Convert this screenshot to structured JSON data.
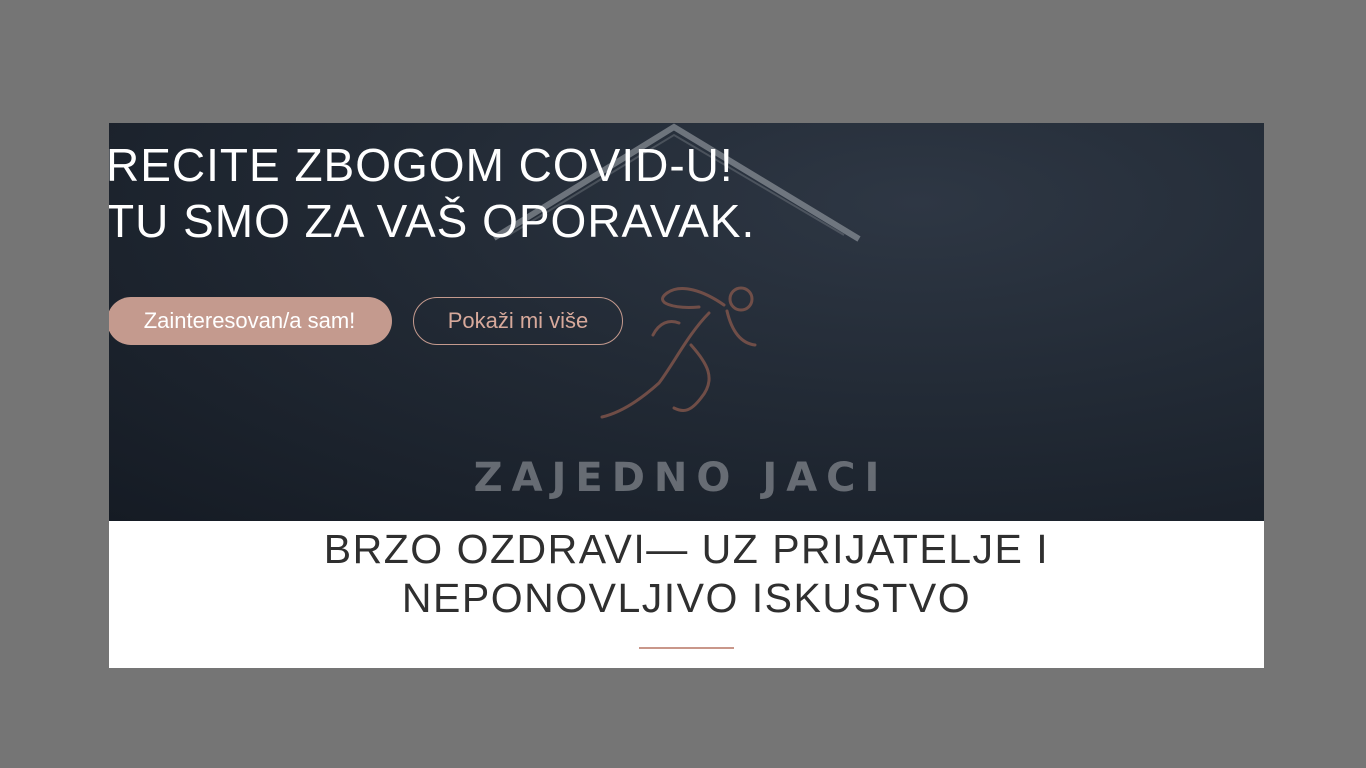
{
  "hero": {
    "title_line1": "RECITE ZBOGOM COVID-U!",
    "title_line2": "TU SMO ZA VAŠ OPORAVAK.",
    "primary_button": "Zainteresovan/a sam!",
    "secondary_button": "Pokaži mi više",
    "logo_text": "ZAJEDNO JACI"
  },
  "section": {
    "title_line1": "BRZO OZDRAVI— UZ PRIJATELJE I",
    "title_line2": "NEPONOVLJIVO ISKUSTVO"
  },
  "colors": {
    "accent": "#c49a8e",
    "hero_bg": "#1c232d",
    "page_bg": "#757575"
  },
  "icons": {
    "logo": "runner-mountain-logo"
  }
}
